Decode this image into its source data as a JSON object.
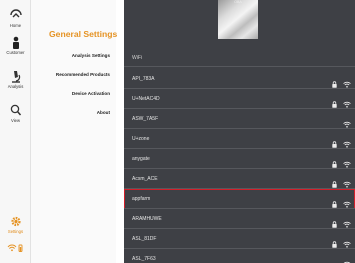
{
  "rail": {
    "home": "Home",
    "customer": "Customer",
    "analysis": "Analysis",
    "view": "View",
    "settings": "Settings"
  },
  "menu": {
    "title": "General Settings",
    "items": [
      "Analysis Settings",
      "Recommended Products",
      "Device Activation",
      "About"
    ]
  },
  "main": {
    "thumb_caption": "OBA",
    "wifi_label": "WiFi",
    "networks": [
      {
        "ssid": "API_783A",
        "locked": true
      },
      {
        "ssid": "U+NetAC4D",
        "locked": true
      },
      {
        "ssid": "ASW_7A5F",
        "locked": false
      },
      {
        "ssid": "U+zone",
        "locked": true
      },
      {
        "ssid": "anygate",
        "locked": true
      },
      {
        "ssid": "Acsm_ACE",
        "locked": true
      },
      {
        "ssid": "appfarm",
        "locked": true
      },
      {
        "ssid": "ARAMHUWE",
        "locked": true
      },
      {
        "ssid": "ASL_81DF",
        "locked": true
      },
      {
        "ssid": "ASL_7F63",
        "locked": false
      }
    ],
    "selected_ssid": "appfarm"
  },
  "colors": {
    "accent": "#e59324",
    "selected_border": "#d21f2a",
    "panel": "#3e4045"
  }
}
